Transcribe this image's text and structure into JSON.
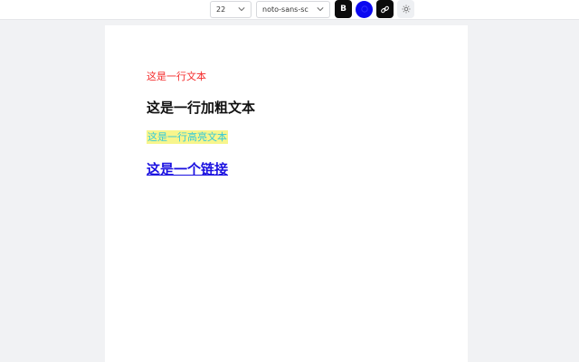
{
  "toolbar": {
    "font_size": "22",
    "font_family": "noto-sans-sc",
    "bold_label": "B",
    "icons": {
      "size_chevron": "chevron-down-icon",
      "font_chevron": "chevron-down-icon",
      "color": "color-picker-icon",
      "link": "link-icon",
      "theme": "sun-icon"
    },
    "colors": {
      "bold_bg": "#0b0b0b",
      "color_swatch": "#0b08f0",
      "link_bg": "#0b0b0b"
    }
  },
  "content": {
    "red_text": "这是一行文本",
    "bold_text": "这是一行加粗文本",
    "highlight_text": "这是一行高亮文本",
    "link_text": "这是一个链接",
    "colors": {
      "red": "#f42b2b",
      "highlight_fg": "#35c9d9",
      "highlight_bg": "#f7f58c",
      "link": "#1a10e0"
    }
  }
}
